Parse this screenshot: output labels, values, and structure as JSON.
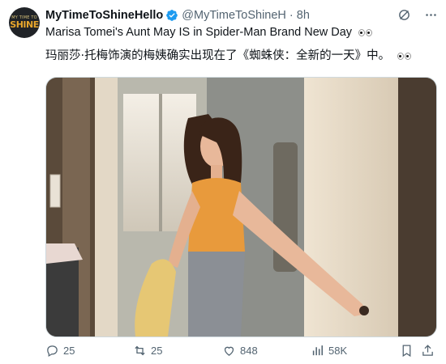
{
  "account": {
    "avatar_line1": "MY TIME TO",
    "avatar_line2": "SHINE",
    "display_name": "MyTimeToShineHello",
    "handle": "@MyTimeToShineH",
    "separator": "·",
    "time": "8h"
  },
  "tweet": {
    "text_line1": "Marisa Tomei's Aunt May IS in Spider-Man Brand New Day",
    "text_line2": "玛丽莎·托梅饰演的梅姨确实出现在了《蜘蛛侠：全新的一天》中。"
  },
  "media": {
    "description": "Photo of a woman in an orange tank top and grey trousers opening a door"
  },
  "actions": {
    "replies": "25",
    "reposts": "25",
    "likes": "848",
    "views": "58K"
  },
  "icons": {
    "verified": "verified-badge-icon",
    "grok": "grok-icon",
    "more": "more-icon",
    "reply": "reply-icon",
    "repost": "repost-icon",
    "like": "heart-icon",
    "views": "views-icon",
    "bookmark": "bookmark-icon",
    "share": "share-icon"
  },
  "colors": {
    "text": "#0f1419",
    "secondary": "#536471",
    "verified": "#1d9bf0"
  }
}
